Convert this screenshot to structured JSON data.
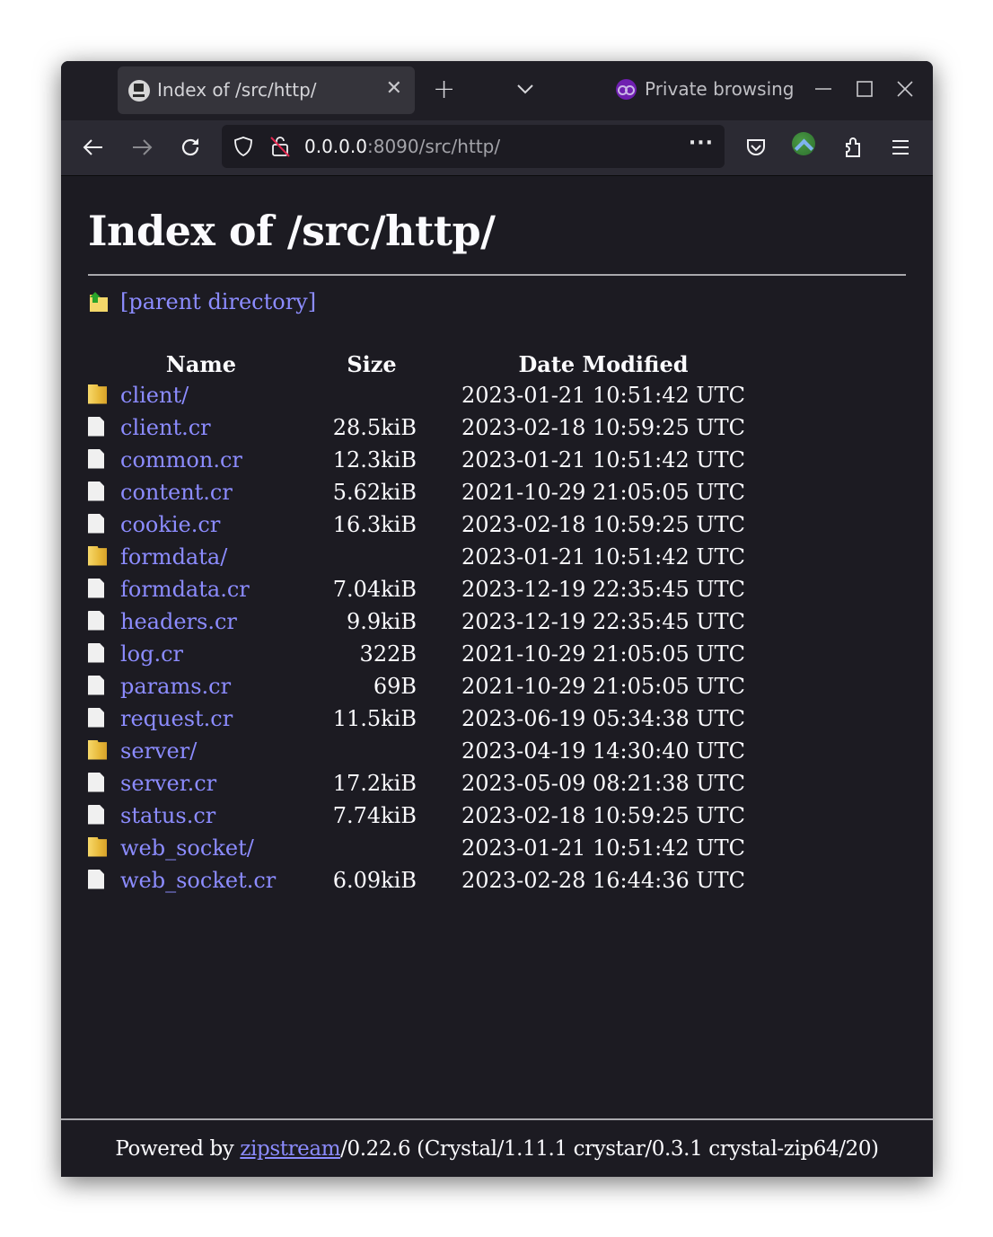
{
  "browser": {
    "tab": {
      "title": "Index of /src/http/",
      "close_icon": "close-icon",
      "favicon": "server-favicon-icon"
    },
    "new_tab_icon": "plus-icon",
    "tab_list_icon": "chevron-down-icon",
    "private_browsing_label": "Private browsing",
    "private_icon": "private-mask-icon",
    "window_controls": [
      "minimize-icon",
      "maximize-icon",
      "close-icon"
    ],
    "nav": {
      "back_icon": "arrow-left-icon",
      "forward_icon": "arrow-right-icon",
      "reload_icon": "reload-icon"
    },
    "url": {
      "host": "0.0.0.0",
      "rest": ":8090/src/http/",
      "more_label": "···"
    },
    "toolbar_icons": [
      "pocket-icon",
      "account-avatar",
      "extensions-icon",
      "hamburger-menu-icon"
    ]
  },
  "page": {
    "title": "Index of /src/http/",
    "parent_link": "[parent directory]",
    "columns": {
      "name": "Name",
      "size": "Size",
      "date": "Date Modified"
    },
    "entries": [
      {
        "type": "folder",
        "name": "client/",
        "size": "",
        "date": "2023-01-21 10:51:42 UTC"
      },
      {
        "type": "file",
        "name": "client.cr",
        "size": "28.5kiB",
        "date": "2023-02-18 10:59:25 UTC"
      },
      {
        "type": "file",
        "name": "common.cr",
        "size": "12.3kiB",
        "date": "2023-01-21 10:51:42 UTC"
      },
      {
        "type": "file",
        "name": "content.cr",
        "size": "5.62kiB",
        "date": "2021-10-29 21:05:05 UTC"
      },
      {
        "type": "file",
        "name": "cookie.cr",
        "size": "16.3kiB",
        "date": "2023-02-18 10:59:25 UTC"
      },
      {
        "type": "folder",
        "name": "formdata/",
        "size": "",
        "date": "2023-01-21 10:51:42 UTC"
      },
      {
        "type": "file",
        "name": "formdata.cr",
        "size": "7.04kiB",
        "date": "2023-12-19 22:35:45 UTC"
      },
      {
        "type": "file",
        "name": "headers.cr",
        "size": "9.9kiB",
        "date": "2023-12-19 22:35:45 UTC"
      },
      {
        "type": "file",
        "name": "log.cr",
        "size": "322B",
        "date": "2021-10-29 21:05:05 UTC"
      },
      {
        "type": "file",
        "name": "params.cr",
        "size": "69B",
        "date": "2021-10-29 21:05:05 UTC"
      },
      {
        "type": "file",
        "name": "request.cr",
        "size": "11.5kiB",
        "date": "2023-06-19 05:34:38 UTC"
      },
      {
        "type": "folder",
        "name": "server/",
        "size": "",
        "date": "2023-04-19 14:30:40 UTC"
      },
      {
        "type": "file",
        "name": "server.cr",
        "size": "17.2kiB",
        "date": "2023-05-09 08:21:38 UTC"
      },
      {
        "type": "file",
        "name": "status.cr",
        "size": "7.74kiB",
        "date": "2023-02-18 10:59:25 UTC"
      },
      {
        "type": "folder",
        "name": "web_socket/",
        "size": "",
        "date": "2023-01-21 10:51:42 UTC"
      },
      {
        "type": "file",
        "name": "web_socket.cr",
        "size": "6.09kiB",
        "date": "2023-02-28 16:44:36 UTC"
      }
    ],
    "footer": {
      "prefix": "Powered by ",
      "link": "zipstream",
      "suffix": "/0.22.6 (Crystal/1.11.1 crystar/0.3.1 crystal-zip64/20)"
    }
  },
  "colors": {
    "page_bg": "#1c1b22",
    "toolbar_bg": "#2b2a33",
    "link": "#8c8cff",
    "text": "#fbfbfe",
    "private_purple": "#6f1fb0",
    "folder_yellow": "#e8b93a"
  }
}
